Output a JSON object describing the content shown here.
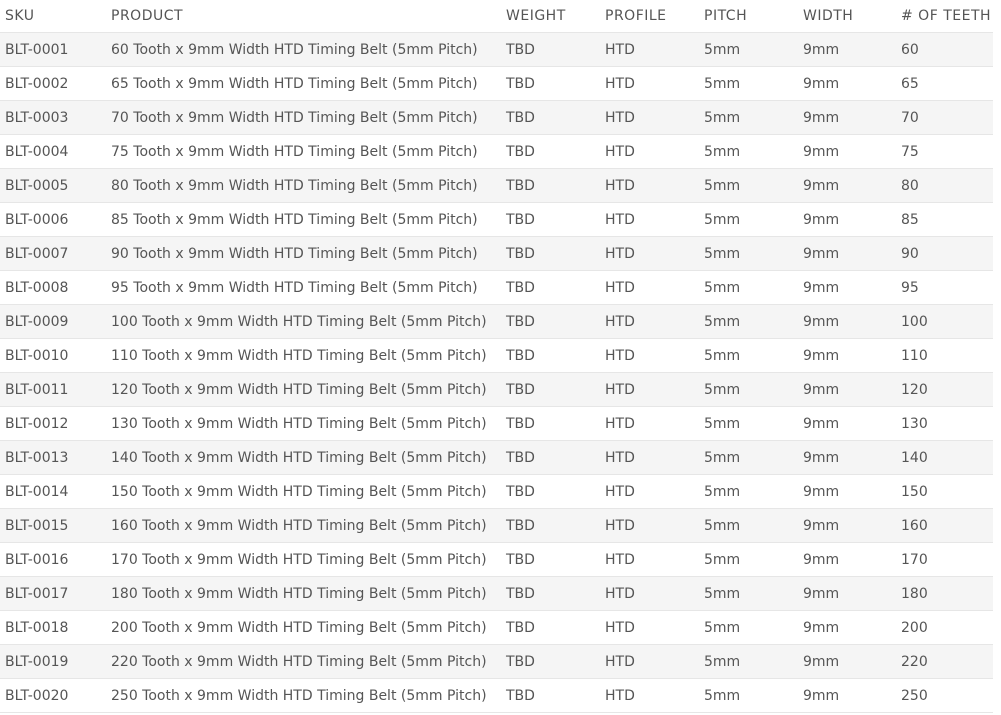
{
  "table": {
    "columns": [
      "SKU",
      "PRODUCT",
      "WEIGHT",
      "PROFILE",
      "PITCH",
      "WIDTH",
      "# OF TEETH"
    ],
    "rows": [
      [
        "BLT-0001",
        "60 Tooth x 9mm Width HTD Timing Belt (5mm Pitch)",
        "TBD",
        "HTD",
        "5mm",
        "9mm",
        "60"
      ],
      [
        "BLT-0002",
        "65 Tooth x 9mm Width HTD Timing Belt (5mm Pitch)",
        "TBD",
        "HTD",
        "5mm",
        "9mm",
        "65"
      ],
      [
        "BLT-0003",
        "70 Tooth x 9mm Width HTD Timing Belt (5mm Pitch)",
        "TBD",
        "HTD",
        "5mm",
        "9mm",
        "70"
      ],
      [
        "BLT-0004",
        "75 Tooth x 9mm Width HTD Timing Belt (5mm Pitch)",
        "TBD",
        "HTD",
        "5mm",
        "9mm",
        "75"
      ],
      [
        "BLT-0005",
        "80 Tooth x 9mm Width HTD Timing Belt (5mm Pitch)",
        "TBD",
        "HTD",
        "5mm",
        "9mm",
        "80"
      ],
      [
        "BLT-0006",
        "85 Tooth x 9mm Width HTD Timing Belt (5mm Pitch)",
        "TBD",
        "HTD",
        "5mm",
        "9mm",
        "85"
      ],
      [
        "BLT-0007",
        "90 Tooth x 9mm Width HTD Timing Belt (5mm Pitch)",
        "TBD",
        "HTD",
        "5mm",
        "9mm",
        "90"
      ],
      [
        "BLT-0008",
        "95 Tooth x 9mm Width HTD Timing Belt (5mm Pitch)",
        "TBD",
        "HTD",
        "5mm",
        "9mm",
        "95"
      ],
      [
        "BLT-0009",
        "100 Tooth x 9mm Width HTD Timing Belt (5mm Pitch)",
        "TBD",
        "HTD",
        "5mm",
        "9mm",
        "100"
      ],
      [
        "BLT-0010",
        "110 Tooth x 9mm Width HTD Timing Belt (5mm Pitch)",
        "TBD",
        "HTD",
        "5mm",
        "9mm",
        "110"
      ],
      [
        "BLT-0011",
        "120 Tooth x 9mm Width HTD Timing Belt (5mm Pitch)",
        "TBD",
        "HTD",
        "5mm",
        "9mm",
        "120"
      ],
      [
        "BLT-0012",
        "130 Tooth x 9mm Width HTD Timing Belt (5mm Pitch)",
        "TBD",
        "HTD",
        "5mm",
        "9mm",
        "130"
      ],
      [
        "BLT-0013",
        "140 Tooth x 9mm Width HTD Timing Belt (5mm Pitch)",
        "TBD",
        "HTD",
        "5mm",
        "9mm",
        "140"
      ],
      [
        "BLT-0014",
        "150 Tooth x 9mm Width HTD Timing Belt (5mm Pitch)",
        "TBD",
        "HTD",
        "5mm",
        "9mm",
        "150"
      ],
      [
        "BLT-0015",
        "160 Tooth x 9mm Width HTD Timing Belt (5mm Pitch)",
        "TBD",
        "HTD",
        "5mm",
        "9mm",
        "160"
      ],
      [
        "BLT-0016",
        "170 Tooth x 9mm Width HTD Timing Belt (5mm Pitch)",
        "TBD",
        "HTD",
        "5mm",
        "9mm",
        "170"
      ],
      [
        "BLT-0017",
        "180 Tooth x 9mm Width HTD Timing Belt (5mm Pitch)",
        "TBD",
        "HTD",
        "5mm",
        "9mm",
        "180"
      ],
      [
        "BLT-0018",
        "200 Tooth x 9mm Width HTD Timing Belt (5mm Pitch)",
        "TBD",
        "HTD",
        "5mm",
        "9mm",
        "200"
      ],
      [
        "BLT-0019",
        "220 Tooth x 9mm Width HTD Timing Belt (5mm Pitch)",
        "TBD",
        "HTD",
        "5mm",
        "9mm",
        "220"
      ],
      [
        "BLT-0020",
        "250 Tooth x 9mm Width HTD Timing Belt (5mm Pitch)",
        "TBD",
        "HTD",
        "5mm",
        "9mm",
        "250"
      ]
    ]
  }
}
